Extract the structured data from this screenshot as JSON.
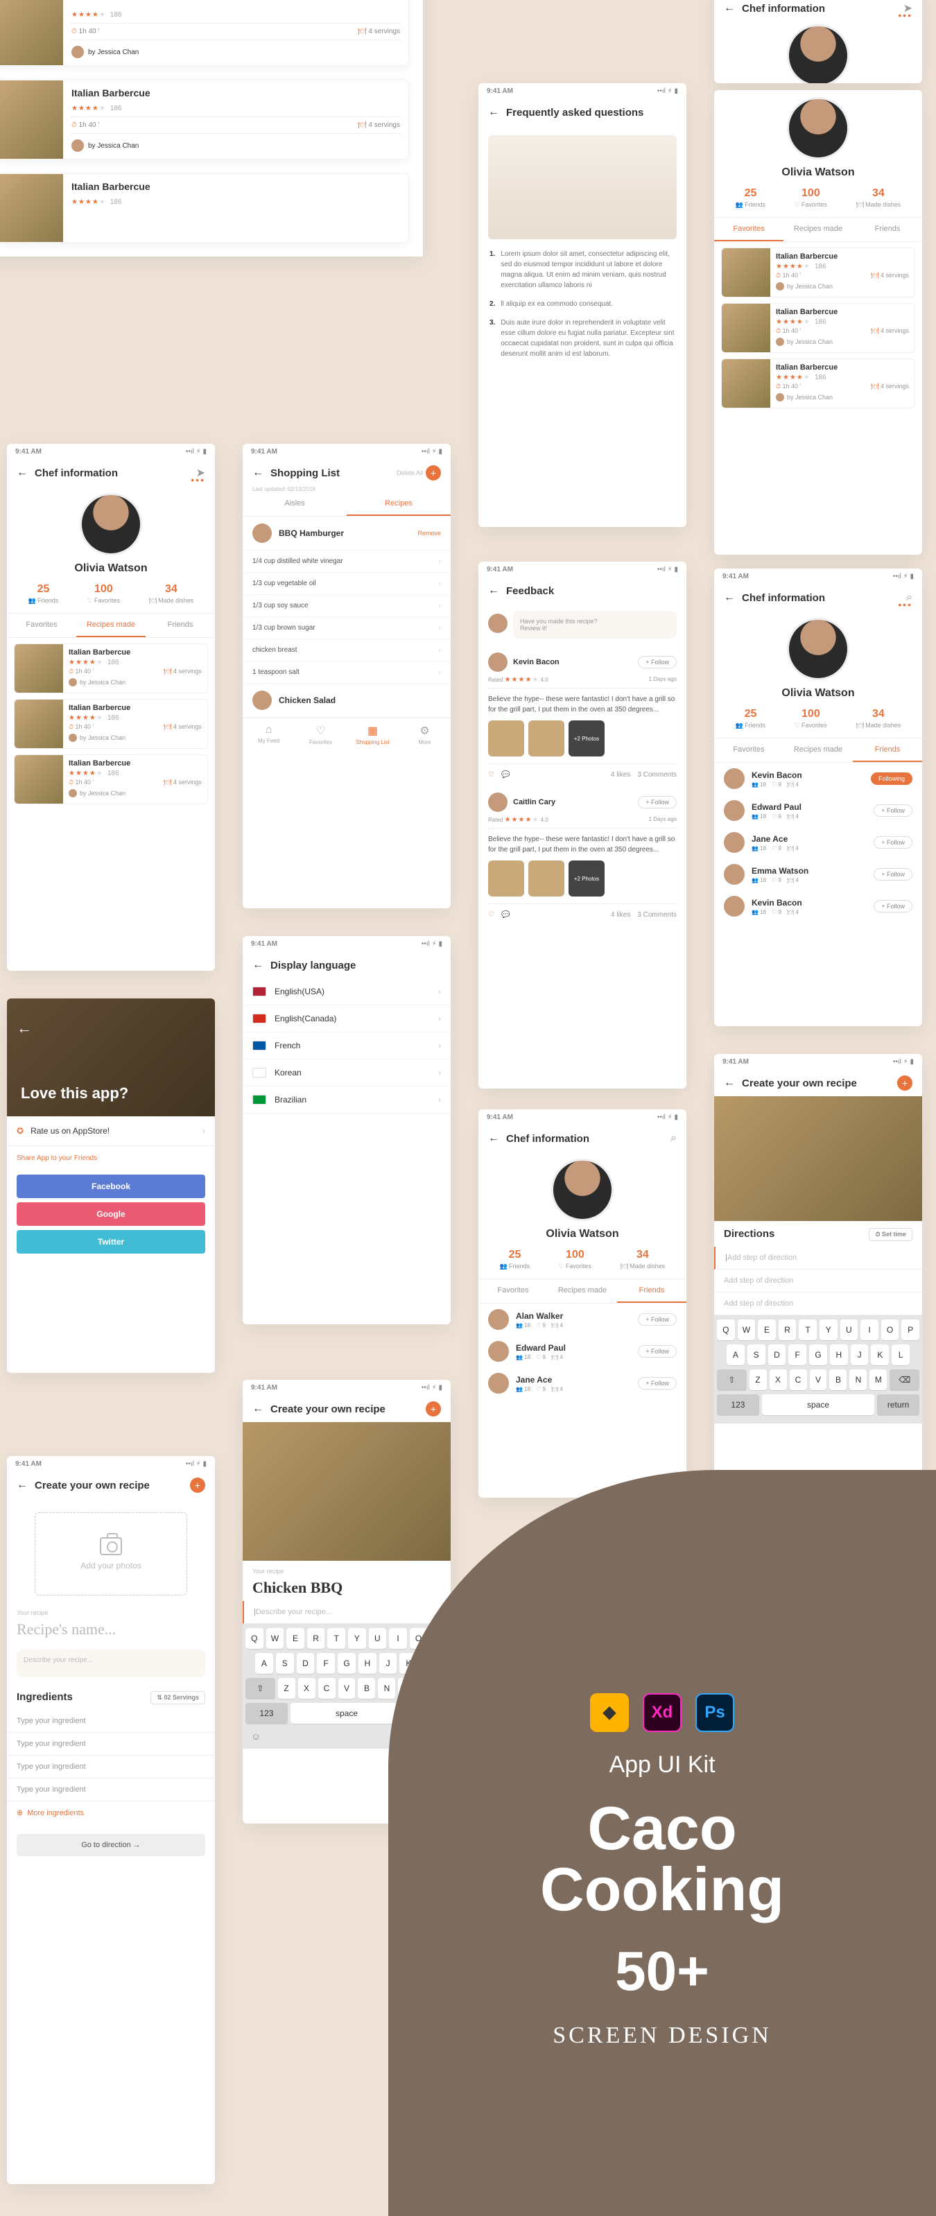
{
  "status": {
    "time": "9:41 AM"
  },
  "chef": {
    "title": "Chef information",
    "name": "Olivia Watson",
    "stats": [
      {
        "num": "25",
        "lbl": "Friends"
      },
      {
        "num": "100",
        "lbl": "Favorites"
      },
      {
        "num": "34",
        "lbl": "Made dishes"
      }
    ],
    "tabs": [
      "Favorites",
      "Recipes made",
      "Friends"
    ]
  },
  "recipe": {
    "title": "Italian Barbercue",
    "count": "186",
    "time": "1h 40 '",
    "servings": "4 servings",
    "by": "by Jessica Chan"
  },
  "smallRecipe": {
    "title": "Italian Barbercue",
    "count": "186",
    "time": "1h 40 '",
    "servings": "4 servings",
    "by": "by Jessica Chan"
  },
  "shopping": {
    "title": "Shopping List",
    "updated": "Last updated: 02/13/2018",
    "delete": "Delete All",
    "tabs": [
      "Aisles",
      "Recipes"
    ],
    "r1": "BBQ Hamburger",
    "r2": "Chicken Salad",
    "remove": "Remove",
    "ings": [
      "1/4 cup distilled white vinegar",
      "1/3 cup vegetable oil",
      "1/3 cup soy sauce",
      "1/3 cup brown sugar",
      "chicken breast",
      "1 teaspoon salt"
    ],
    "nav": [
      "My Feed",
      "Favorites",
      "Shopping List",
      "More"
    ]
  },
  "lang": {
    "title": "Display language",
    "items": [
      {
        "n": "English(USA)",
        "c": "#b22234"
      },
      {
        "n": "English(Canada)",
        "c": "#d52b1e"
      },
      {
        "n": "French",
        "c": "#0055a4"
      },
      {
        "n": "Korean",
        "c": "#fff"
      },
      {
        "n": "Brazilian",
        "c": "#009739"
      }
    ]
  },
  "faq": {
    "title": "Frequently asked questions",
    "items": [
      "Lorem ipsum dolor sit amet, consectetur adipiscing elit, sed do eiusmod tempor incididunt ut labore et dolore magna aliqua. Ut enim ad minim veniam, quis nostrud exercitation ullamco laboris ni",
      "ll aliquip ex ea commodo consequat.",
      "Duis aute irure dolor in reprehenderit in voluptate velit esse cillum dolore eu fugiat nulla pariatur. Excepteur sint occaecat cupidatat non proident, sunt in culpa qui officia deserunt mollit anim id est laborum."
    ]
  },
  "love": {
    "title": "Love this app?",
    "rate": "Rate us on AppStore!",
    "share": "Share App to your Friends",
    "buttons": [
      "Facebook",
      "Google",
      "Twitter"
    ]
  },
  "feedback": {
    "title": "Feedback",
    "prompt": "Have you made this recipe?\nReview it!",
    "posts": [
      {
        "name": "Kevin Bacon",
        "rating": "4.0",
        "days": "1 Days ago",
        "txt": "Believe the hype-- these were fantastic! I don't have a grill so for the grill part, I put them in the oven at 350 degrees...",
        "more": "+2\nPhotos",
        "likes": "4 likes",
        "comments": "3 Comments"
      },
      {
        "name": "Caitlin Cary",
        "rating": "4.0",
        "days": "1 Days ago",
        "txt": "Believe the hype-- these were fantastic! I don't have a grill so for the grill part, I put them in the oven at 350 degrees...",
        "more": "+2\nPhotos",
        "likes": "4 likes",
        "comments": "3 Comments"
      }
    ],
    "follow": "+ Follow",
    "rated": "Rated"
  },
  "friends": [
    {
      "n": "Kevin Bacon"
    },
    {
      "n": "Edward Paul"
    },
    {
      "n": "Jane Ace"
    },
    {
      "n": "Emma Watson"
    },
    {
      "n": "Kevin Bacon"
    }
  ],
  "friends2": [
    {
      "n": "Alan Walker"
    },
    {
      "n": "Edward Paul"
    },
    {
      "n": "Jane Ace"
    }
  ],
  "friendMini": {
    "a": "18",
    "b": "9",
    "c": "4"
  },
  "following": "Following",
  "follow": "+ Follow",
  "create": {
    "title": "Create your own recipe",
    "addPhoto": "Add your photos",
    "yourRecipe": "Your recipe",
    "namePlaceholder": "Recipe's name...",
    "descPlaceholder": "Describe your recipe...",
    "ingredients": "Ingredients",
    "servings": "⇅ 02  Servings",
    "ingPlaceholder": "Type your ingredient",
    "more": "More ingredients",
    "go": "Go to direction →",
    "recipeName": "Chicken BBQ",
    "desc2": "Describe your recipe...",
    "directions": "Directions",
    "setTime": "⏱ Set time",
    "addStep": "Add step of direction"
  },
  "keys": {
    "r1": [
      "Q",
      "W",
      "E",
      "R",
      "T",
      "Y",
      "U",
      "I",
      "O",
      "P"
    ],
    "r2": [
      "A",
      "S",
      "D",
      "F",
      "G",
      "H",
      "J",
      "K",
      "L"
    ],
    "r3": [
      "Z",
      "X",
      "C",
      "V",
      "B",
      "N",
      "M"
    ],
    "shift": "⇧",
    "bs": "⌫",
    "num": "123",
    "space": "space",
    "ret": "return",
    "emoji": "☺"
  },
  "promo": {
    "t1": "App UI Kit",
    "t2": "Caco\nCooking",
    "t3": "50+",
    "t4": "SCREEN DESIGN"
  }
}
